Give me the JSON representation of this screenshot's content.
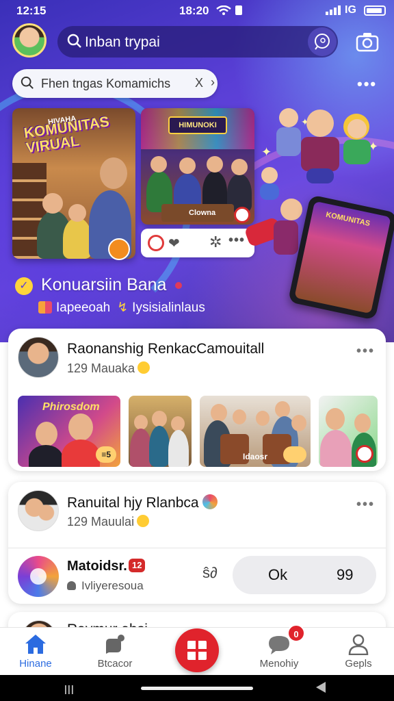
{
  "status": {
    "time_left": "12:15",
    "time_center": "18:20",
    "symbol": "IG"
  },
  "header": {
    "search_text": "Inban trypai",
    "filter_text": "Fhen tngas Komamichs",
    "filter_clear": "X",
    "filter_next": "›"
  },
  "hero": {
    "card1": {
      "small_text": "HIVAHA",
      "title": "KOMUNITAS VIRUAL"
    },
    "card2": {
      "sign": "HIMUNOKI",
      "table_label": "Clowna"
    },
    "phone_title": "KOMUNITAS",
    "brand_icon": "✓",
    "brand_name": "Konuarsiin Bana",
    "sub_left": "Iapeeoah",
    "sub_right": "Iysisialinlaus"
  },
  "posts": [
    {
      "title": "Raonanshig RenkacCamouitall",
      "meta": "129 Mauaka",
      "thumbs": [
        {
          "title": "Phirosdom",
          "badge": "≡5"
        },
        {
          "label": ""
        },
        {
          "label": "Idaosr"
        },
        {
          "badge": ""
        }
      ]
    },
    {
      "title": "Ranuital hjy Rlanbca",
      "meta": "129 Mauulai",
      "sub": {
        "name": "Matoidsr.",
        "badge": "12",
        "caption": "Ivliyeresoua",
        "share": "ŝ∂",
        "pill_a": "Ok",
        "pill_b": "99"
      }
    },
    {
      "title": "Raymur ahsi"
    }
  ],
  "nav": {
    "home": "Hinane",
    "discover": "Btcacor",
    "messages": "Menohiy",
    "profile": "Gepls",
    "notif_count": "0"
  },
  "colors": {
    "accent": "#2b6be0",
    "brand_red": "#e0232c",
    "hero_purple": "#5a3fd6"
  }
}
